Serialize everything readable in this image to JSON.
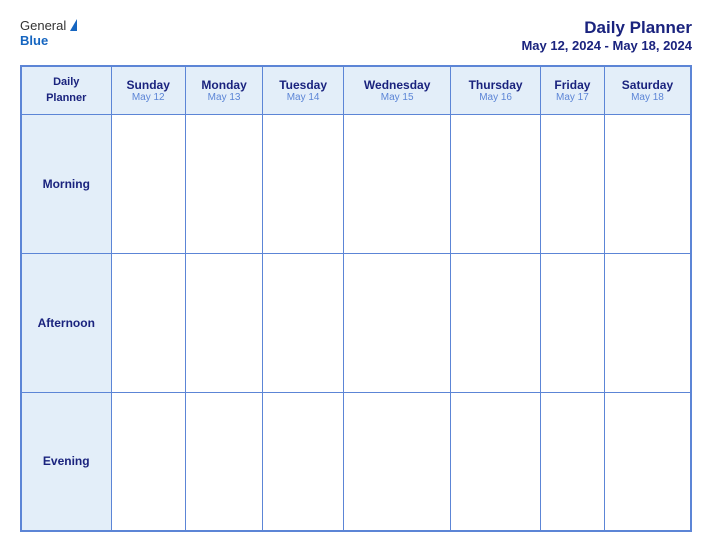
{
  "header": {
    "logo_general": "General",
    "logo_blue": "Blue",
    "title": "Daily Planner",
    "date_range": "May 12, 2024 - May 18, 2024"
  },
  "table": {
    "header_label_line1": "Daily",
    "header_label_line2": "Planner",
    "days": [
      {
        "name": "Sunday",
        "date": "May 12"
      },
      {
        "name": "Monday",
        "date": "May 13"
      },
      {
        "name": "Tuesday",
        "date": "May 14"
      },
      {
        "name": "Wednesday",
        "date": "May 15"
      },
      {
        "name": "Thursday",
        "date": "May 16"
      },
      {
        "name": "Friday",
        "date": "May 17"
      },
      {
        "name": "Saturday",
        "date": "May 18"
      }
    ],
    "rows": [
      {
        "label": "Morning"
      },
      {
        "label": "Afternoon"
      },
      {
        "label": "Evening"
      }
    ]
  }
}
